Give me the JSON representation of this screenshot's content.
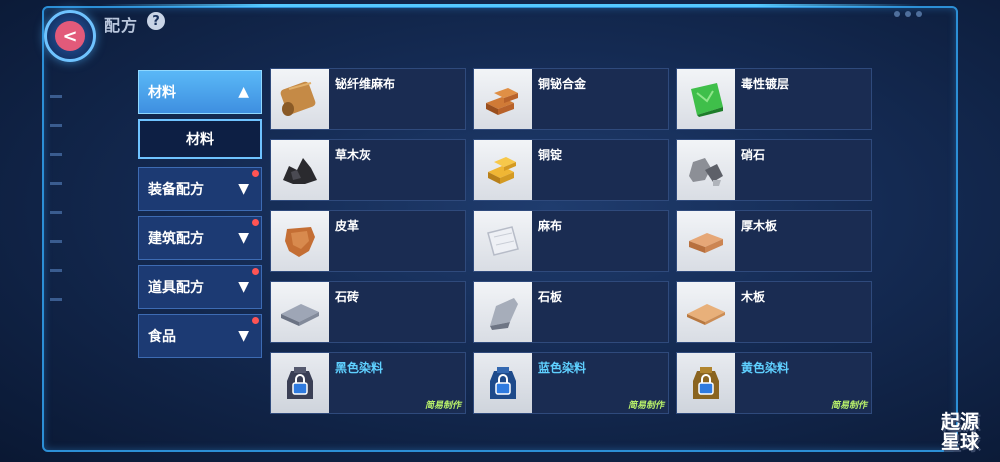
{
  "header": {
    "title": "配方",
    "help_label": "?"
  },
  "back_button": {
    "glyph": "<"
  },
  "menu": {
    "active": {
      "label": "材料",
      "arrow": "▲"
    },
    "sub": {
      "label": "材料"
    },
    "items": [
      {
        "label": "装备配方",
        "arrow": "▼"
      },
      {
        "label": "建筑配方",
        "arrow": "▼"
      },
      {
        "label": "道具配方",
        "arrow": "▼"
      },
      {
        "label": "食品",
        "arrow": "▼"
      }
    ]
  },
  "recipes": [
    {
      "name": "铋纤维麻布",
      "icon": "cloth-roll-icon"
    },
    {
      "name": "铜铋合金",
      "icon": "alloy-ingot-icon"
    },
    {
      "name": "毒性镀层",
      "icon": "toxic-sheet-icon"
    },
    {
      "name": "草木灰",
      "icon": "ash-icon"
    },
    {
      "name": "铜锭",
      "icon": "copper-ingot-icon"
    },
    {
      "name": "硝石",
      "icon": "saltpeter-icon"
    },
    {
      "name": "皮革",
      "icon": "leather-icon"
    },
    {
      "name": "麻布",
      "icon": "linen-icon"
    },
    {
      "name": "厚木板",
      "icon": "thick-plank-icon"
    },
    {
      "name": "石砖",
      "icon": "stone-brick-icon"
    },
    {
      "name": "石板",
      "icon": "stone-slab-icon"
    },
    {
      "name": "木板",
      "icon": "plank-icon"
    },
    {
      "name": "黑色染料",
      "icon": "locked-dye-icon",
      "tag": "简易制作"
    },
    {
      "name": "蓝色染料",
      "icon": "locked-dye-icon",
      "tag": "简易制作"
    },
    {
      "name": "黄色染料",
      "icon": "locked-dye-icon",
      "tag": "简易制作"
    }
  ],
  "logo": {
    "line1": "起源",
    "line2": "星球"
  },
  "colors": {
    "frame": "#2c8fd6",
    "active_tab": "#4fa6ef",
    "dye_text": "#5fd0ff",
    "tag_text": "#b8f06a",
    "notify_dot": "#ff5454"
  }
}
